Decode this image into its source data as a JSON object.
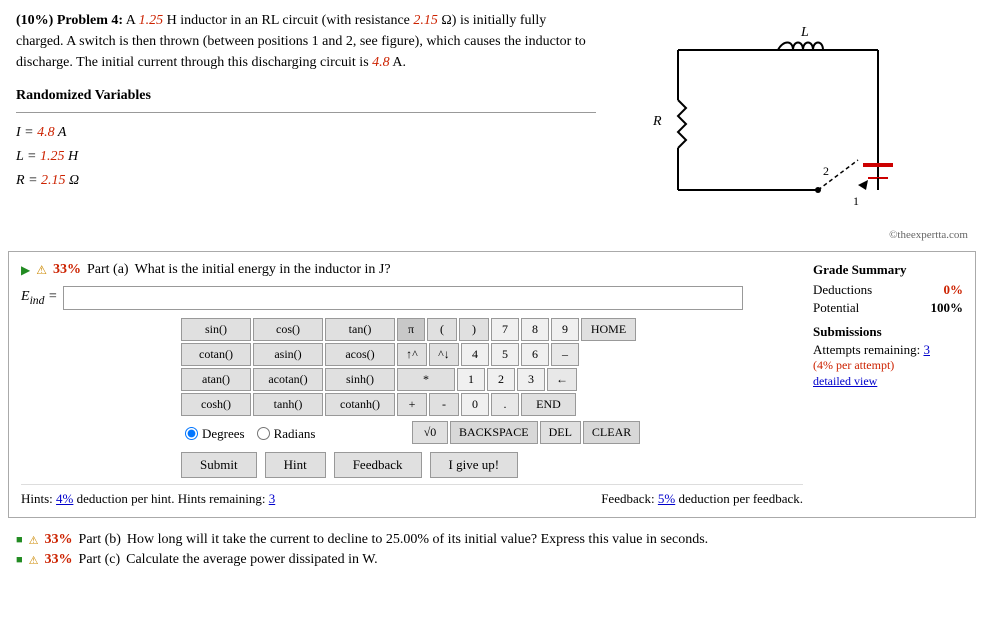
{
  "problem": {
    "header": "(10%) Problem 4:",
    "description_before": "A",
    "L_val": "1.25",
    "L_unit": "H inductor in an RL circuit (with resistance",
    "R_val": "2.15",
    "R_unit": "Ω) is initially fully charged. A switch is then thrown (between positions 1 and 2, see figure), which causes the inductor to discharge. The initial current through this discharging circuit is",
    "I_val": "4.8",
    "I_unit": "A.",
    "randomized_title": "Randomized Variables",
    "vars": [
      {
        "label": "I = ",
        "val": "4.8",
        "unit": " A"
      },
      {
        "label": "L = ",
        "val": "1.25",
        "unit": " H"
      },
      {
        "label": "R = ",
        "val": "2.15",
        "unit": " Ω"
      }
    ],
    "copyright": "©theexpertta.com"
  },
  "part_a": {
    "percent": "33%",
    "label": "Part (a)",
    "question": "What is the initial energy in the inductor in J?",
    "input_label": "E_ind =",
    "input_placeholder": "",
    "grade_summary": {
      "title": "Grade Summary",
      "deductions_label": "Deductions",
      "deductions_val": "0%",
      "potential_label": "Potential",
      "potential_val": "100%",
      "submissions_title": "Submissions",
      "attempts_label": "Attempts remaining:",
      "attempts_val": "3",
      "per_attempt": "(4% per attempt)",
      "detail_link": "detailed view"
    },
    "calculator": {
      "buttons_row1": [
        "sin()",
        "cos()",
        "tan()",
        "π",
        "(",
        ")",
        "7",
        "8",
        "9",
        "HOME"
      ],
      "buttons_row2": [
        "cotan()",
        "asin()",
        "acos()",
        "↑^",
        "^↓",
        "4",
        "5",
        "6",
        "–"
      ],
      "buttons_row3": [
        "atan()",
        "acotan()",
        "sinh()",
        "*",
        "1",
        "2",
        "3",
        "←"
      ],
      "buttons_row4": [
        "cosh()",
        "tanh()",
        "cotanh()",
        "+",
        "-",
        "0",
        ".",
        "END"
      ],
      "buttons_row5": [
        "Degrees",
        "Radians",
        "√0",
        "BACKSPACE",
        "DEL",
        "CLEAR"
      ]
    },
    "action_buttons": {
      "submit": "Submit",
      "hint": "Hint",
      "feedback": "Feedback",
      "give_up": "I give up!"
    },
    "hints_text": "Hints:",
    "hints_pct": "4%",
    "hints_suffix": "deduction per hint. Hints remaining:",
    "hints_remaining": "3",
    "feedback_text": "Feedback:",
    "feedback_pct": "5%",
    "feedback_suffix": "deduction per feedback."
  },
  "part_b": {
    "percent": "33%",
    "label": "Part (b)",
    "question": "How long will it take the current to decline to 25.00% of its initial value? Express this value in seconds."
  },
  "part_c": {
    "percent": "33%",
    "label": "Part (c)",
    "question": "Calculate the average power dissipated in W."
  }
}
